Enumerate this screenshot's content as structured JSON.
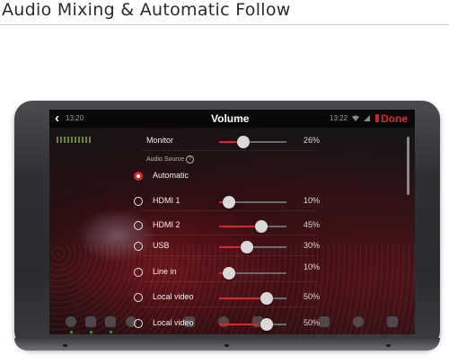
{
  "header": {
    "title": "Audio Mixing & Automatic Follow"
  },
  "status": {
    "time_left": "13:20",
    "time_right": "13:22"
  },
  "screen": {
    "title": "Volume",
    "done_label": "Done"
  },
  "monitor": {
    "label": "Monitor",
    "value_label": "26%",
    "value": 0.26
  },
  "audio_source": {
    "label": "Audio Source"
  },
  "sources": [
    {
      "label": "Automatic",
      "selected": true
    },
    {
      "label": "HDMI 1",
      "value_label": "10%",
      "value": 0.1
    },
    {
      "label": "HDMI 2",
      "value_label": "45%",
      "value": 0.45
    },
    {
      "label": "USB",
      "value_label": "30%",
      "value": 0.3
    },
    {
      "label": "Line in",
      "value_label": "10%",
      "value": 0.1
    },
    {
      "label": "Local video",
      "value_label": "50%",
      "value": 0.5
    },
    {
      "label": "Local video",
      "value_label": "50%",
      "value": 0.5
    }
  ],
  "colors": {
    "accent": "#e0242c",
    "slider_fill": "#d42a2f",
    "level_meter": "#6a8a2a"
  },
  "icons": [
    "back-icon",
    "wifi-icon",
    "signal-icon",
    "battery-icon",
    "help-icon",
    "facebook-icon",
    "youtube-icon",
    "twitch-icon",
    "play-icon",
    "layers-icon",
    "share-icon",
    "media-icon",
    "film-icon",
    "settings-icon",
    "dice-icon"
  ]
}
